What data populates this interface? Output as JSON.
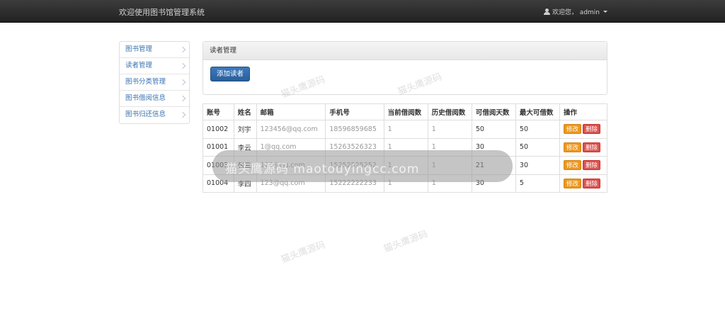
{
  "navbar": {
    "brand": "欢迎使用图书馆管理系统",
    "user_greeting": "欢迎您， admin"
  },
  "sidebar": {
    "items": [
      {
        "label": "图书管理"
      },
      {
        "label": "读者管理"
      },
      {
        "label": "图书分类管理"
      },
      {
        "label": "图书借阅信息"
      },
      {
        "label": "图书归还信息"
      }
    ]
  },
  "panel": {
    "title": "读者管理",
    "add_button": "添加读者"
  },
  "table": {
    "headers": [
      "账号",
      "姓名",
      "邮箱",
      "手机号",
      "当前借阅数",
      "历史借阅数",
      "可借阅天数",
      "最大可借数",
      "操作"
    ],
    "rows": [
      [
        "01002",
        "刘宇",
        "123456@qq.com",
        "18596859685",
        "1",
        "1",
        "50",
        "50"
      ],
      [
        "01001",
        "李云",
        "1@qq.com",
        "15263526323",
        "1",
        "1",
        "30",
        "50"
      ],
      [
        "01003",
        "张三",
        "123@qq.com",
        "15252525252",
        "1",
        "1",
        "21",
        "30"
      ],
      [
        "01004",
        "李四",
        "123@qq.com",
        "15222222233",
        "1",
        "1",
        "30",
        "5"
      ]
    ],
    "edit_label": "修改",
    "delete_label": "删除"
  },
  "watermark": {
    "band_text": "猫头鹰源码 maotouyingcc.com",
    "faint_text": "猫头鹰源码"
  },
  "colors": {
    "navbar": "#222222",
    "link": "#3a74b0",
    "primary": "#2a5e98",
    "warning": "#ec971f",
    "danger": "#d9534f"
  }
}
